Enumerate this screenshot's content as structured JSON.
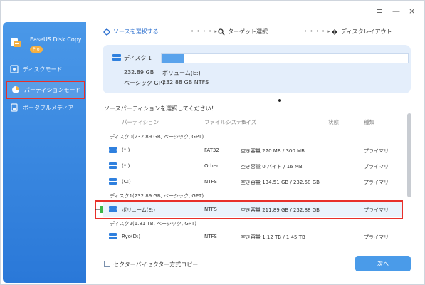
{
  "window": {
    "menu_icon": "menu-icon",
    "minimize": "—",
    "close": "×"
  },
  "sidebar": {
    "brand_name": "EaseUS Disk Copy",
    "brand_badge": "Pro",
    "items": [
      {
        "label": "ディスクモード",
        "icon": "disk-icon"
      },
      {
        "label": "パーティションモード",
        "icon": "partition-icon",
        "active": true
      },
      {
        "label": "ポータブルメディア",
        "icon": "portable-icon"
      }
    ]
  },
  "steps": [
    {
      "label": "ソースを選択する",
      "icon": "target-icon"
    },
    {
      "label": "ターゲット選択",
      "icon": "search-icon"
    },
    {
      "label": "ディスクレイアウト",
      "icon": "layout-icon"
    }
  ],
  "step_separator": "• • • • ▸",
  "disk_card": {
    "name": "ディスク 1",
    "size": "232.89 GB",
    "type": "ベーシック GPT",
    "volume_name": "ボリューム(E:)",
    "volume_info": "232.88 GB NTFS",
    "used_fraction": 0.09
  },
  "prompt": "ソースパーティションを選択してください！",
  "table": {
    "headers": {
      "partition": "パーティション",
      "fs": "ファイルシステム",
      "size": "サイズ",
      "status": "状態",
      "type": "種類"
    },
    "groups": [
      {
        "label": "ディスク0(232.89 GB, ベーシック, GPT)"
      },
      {
        "label": "ディスク1(232.89 GB, ベーシック, GPT)"
      },
      {
        "label": "ディスク2(1.81 TB, ベーシック, GPT)"
      }
    ],
    "rows": [
      {
        "name": "(*:)",
        "fs": "FAT32",
        "capacity": "空き容量 270 MB / 300 MB",
        "type": "プライマリ"
      },
      {
        "name": "(*:)",
        "fs": "Other",
        "capacity": "空き容量 0 バイト / 16 MB",
        "type": "プライマリ"
      },
      {
        "name": "(C:)",
        "fs": "NTFS",
        "capacity": "空き容量 134.51 GB / 232.58 GB",
        "type": "プライマリ"
      },
      {
        "name": "ボリューム(E:)",
        "fs": "NTFS",
        "capacity": "空き容量 211.89 GB / 232.88 GB",
        "type": "プライマリ",
        "selected": true
      },
      {
        "name": "Ryo(D:)",
        "fs": "NTFS",
        "capacity": "空き容量 1.12 TB / 1.45 TB",
        "type": "プライマリ"
      }
    ]
  },
  "footer": {
    "sector_copy_label": "セクターバイセクター方式コピー",
    "next_label": "次へ"
  },
  "colors": {
    "accent": "#2f80de",
    "highlight_outline": "#e8302a",
    "selected_row": "#eaf3fc"
  }
}
